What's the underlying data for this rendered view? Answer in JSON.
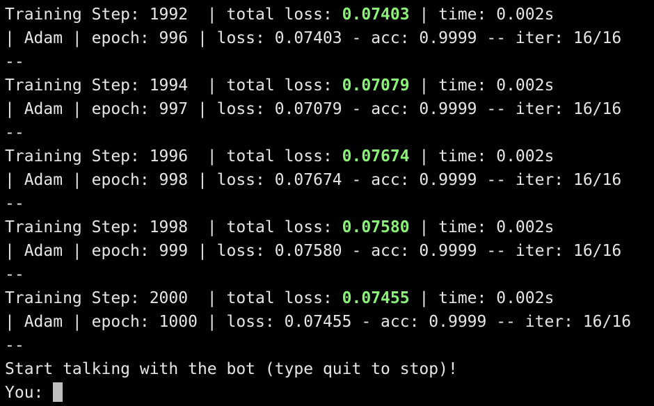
{
  "colors": {
    "background": "#000000",
    "text": "#e6e6e6",
    "highlight": "#8cf27a",
    "cursor": "#bfbfbf"
  },
  "blocks": [
    {
      "step_prefix": "Training Step: 1992  | total loss: ",
      "total_loss": "0.07403",
      "step_suffix": " | time: 0.002s",
      "detail": "| Adam | epoch: 996 | loss: 0.07403 - acc: 0.9999 -- iter: 16/16",
      "separator": "--"
    },
    {
      "step_prefix": "Training Step: 1994  | total loss: ",
      "total_loss": "0.07079",
      "step_suffix": " | time: 0.002s",
      "detail": "| Adam | epoch: 997 | loss: 0.07079 - acc: 0.9999 -- iter: 16/16",
      "separator": "--"
    },
    {
      "step_prefix": "Training Step: 1996  | total loss: ",
      "total_loss": "0.07674",
      "step_suffix": " | time: 0.002s",
      "detail": "| Adam | epoch: 998 | loss: 0.07674 - acc: 0.9999 -- iter: 16/16",
      "separator": "--"
    },
    {
      "step_prefix": "Training Step: 1998  | total loss: ",
      "total_loss": "0.07580",
      "step_suffix": " | time: 0.002s",
      "detail": "| Adam | epoch: 999 | loss: 0.07580 - acc: 0.9999 -- iter: 16/16",
      "separator": "--"
    },
    {
      "step_prefix": "Training Step: 2000  | total loss: ",
      "total_loss": "0.07455",
      "step_suffix": " | time: 0.002s",
      "detail": "| Adam | epoch: 1000 | loss: 0.07455 - acc: 0.9999 -- iter: 16/16",
      "separator": "--"
    }
  ],
  "prompt_message": "Start talking with the bot (type quit to stop)!",
  "input_prompt": "You: "
}
